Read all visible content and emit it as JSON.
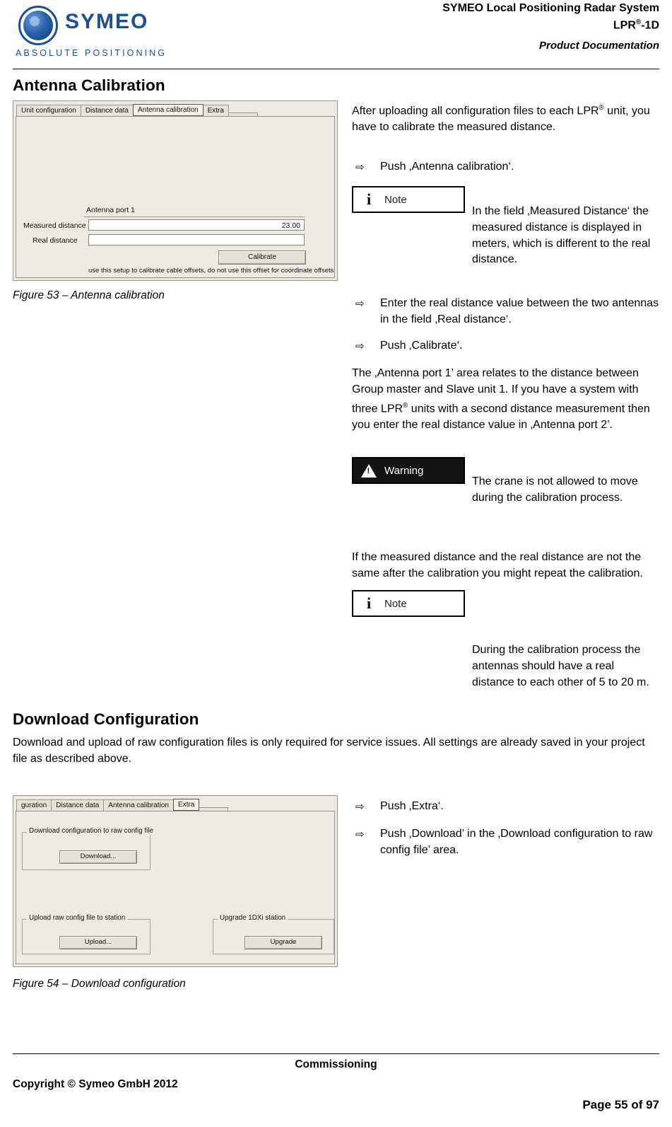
{
  "header": {
    "logo_word": "SYMEO",
    "logo_tagline": "ABSOLUTE POSITIONING",
    "title_line1": "SYMEO Local Positioning Radar System",
    "title_line2_pre": "LPR",
    "title_line2_sup": "®",
    "title_line2_post": "-1D",
    "subtitle": "Product Documentation"
  },
  "sections": {
    "antenna_heading": "Antenna Calibration",
    "download_heading": "Download Configuration"
  },
  "figure53": {
    "caption": "Figure 53 – Antenna calibration",
    "tabs": [
      {
        "label": "Unit configuration",
        "active": false
      },
      {
        "label": "Distance data",
        "active": false
      },
      {
        "label": "Antenna calibration",
        "active": true
      },
      {
        "label": "Extra",
        "active": false
      }
    ],
    "group_title": "Antenna port  1",
    "measured_distance_label": "Measured distance",
    "measured_distance_value": "23.00",
    "real_distance_label": "Real distance",
    "real_distance_value": "",
    "calibrate_button": "Calibrate",
    "footnote": "use this setup to calibrate cable offsets, do not use this offset for coordinate offsets"
  },
  "figure54": {
    "caption": "Figure 54 – Download configuration",
    "tabs": [
      {
        "label": "guration",
        "active": false
      },
      {
        "label": "Distance data",
        "active": false
      },
      {
        "label": "Antenna calibration",
        "active": false
      },
      {
        "label": "Extra",
        "active": true
      }
    ],
    "download_group_title": "Download configuration to raw config file",
    "download_button": "Download...",
    "upload_group_title": "Upload raw config file to station",
    "upload_button": "Upload...",
    "upgrade_group_title": "Upgrade 1DXi station",
    "upgrade_button": "Upgrade"
  },
  "body": {
    "p1_pre": "After uploading all configuration files to each LPR",
    "p1_sup": "®",
    "p1_post": " unit, you have to calibrate the measured distance.",
    "b1": "Push ‚Antenna calibration‘.",
    "note1_label": "Note",
    "note1_icon": "i",
    "note1_text": "In the field ‚Measured Distance‘ the measured distance is displayed in meters, which is different to the real distance.",
    "b2": "Enter the real distance value between the two antennas in the field ‚Real distance‘.",
    "b3": "Push ‚Calibrate‘.",
    "p2_pre": "The ‚Antenna port 1’ area relates to the distance between Group master and Slave unit 1. If you have a system with three LPR",
    "p2_sup": "®",
    "p2_post": " units with a second distance measurement then you enter the real distance value in ‚Antenna port 2’.",
    "warning_label": "Warning",
    "warning_text": "The crane is not allowed to move during the calibration process.",
    "p3": "If the measured distance and the real distance are not the same after the calibration you might repeat the calibration.",
    "note2_label": "Note",
    "note2_icon": "i",
    "note2_text": "During the calibration process the antennas should have a real distance to each other of 5 to 20 m.",
    "p4": "Download and upload of raw configuration files is only required for service issues. All settings are already saved in your project file as described above.",
    "b4": "Push ‚Extra‘.",
    "b5": "Push ‚Download’ in the ‚Download configuration to raw config file’ area."
  },
  "footer": {
    "center": "Commissioning",
    "left": "Copyright © Symeo GmbH 2012",
    "right": "Page 55 of 97"
  },
  "colors": {
    "brand_blue": "#1b4f9c",
    "panel_bg": "#eceae2"
  }
}
